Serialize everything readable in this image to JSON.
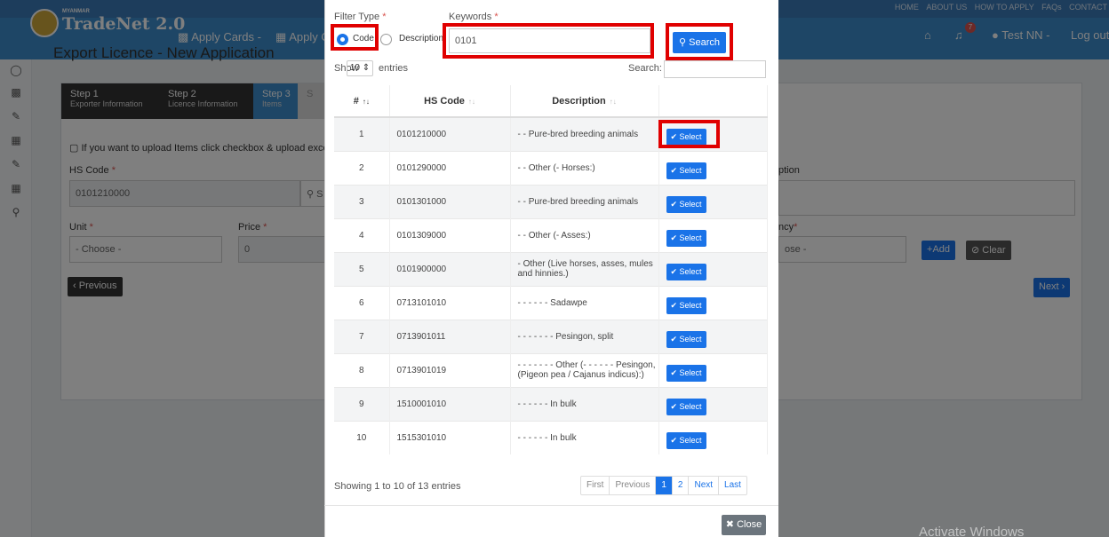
{
  "top_links": [
    "HOME",
    "ABOUT US",
    "HOW TO APPLY",
    "FAQs",
    "CONTACT"
  ],
  "brand": {
    "small": "MYANMAR",
    "name": "TradeNet 2.0"
  },
  "nav": {
    "apply_cards": "Apply Cards -",
    "apply_other": "Apply O",
    "notifications": "7",
    "user": "Test NN -",
    "logout": "Log out"
  },
  "page": {
    "title": "Export Licence - New Application"
  },
  "steps": [
    {
      "title": "Step 1",
      "sub": "Exporter Information"
    },
    {
      "title": "Step 2",
      "sub": "Licence Information"
    },
    {
      "title": "Step 3",
      "sub": "Items"
    },
    {
      "title": "S",
      "sub": "S"
    }
  ],
  "form": {
    "upload_note": "If you want to upload Items click checkbox & upload excel file. Dow",
    "hs_code_label": "HS Code",
    "hs_code_value": "0101210000",
    "hs_search": "S",
    "unit_label": "Unit",
    "unit_value": "- Choose -",
    "price_label": "Price",
    "price_value": "0",
    "description_label": "ption",
    "currency_label": "ncy",
    "currency_value": "ose -",
    "add": "Add",
    "clear": "Clear",
    "previous": "Previous",
    "next": "Next"
  },
  "modal": {
    "filter_type_label": "Filter Type",
    "filter_options": [
      "Code",
      "Description"
    ],
    "filter_selected": "Code",
    "keywords_label": "Keywords",
    "keywords_value": "0101",
    "search_button": "Search",
    "show_label": "Show",
    "page_size": "10",
    "entries_label": "entries",
    "search_label": "Search:",
    "columns": [
      "#",
      "HS Code",
      "Description",
      ""
    ],
    "select_label": "Select",
    "rows": [
      {
        "n": "1",
        "code": "0101210000",
        "desc": "- - Pure-bred breeding animals"
      },
      {
        "n": "2",
        "code": "0101290000",
        "desc": "- - Other (- Horses:)"
      },
      {
        "n": "3",
        "code": "0101301000",
        "desc": "- - Pure-bred breeding animals"
      },
      {
        "n": "4",
        "code": "0101309000",
        "desc": "- - Other (- Asses:)"
      },
      {
        "n": "5",
        "code": "0101900000",
        "desc": "- Other (Live horses, asses, mules and hinnies.)"
      },
      {
        "n": "6",
        "code": "0713101010",
        "desc": "- - - - - - Sadawpe"
      },
      {
        "n": "7",
        "code": "0713901011",
        "desc": "- - - - - - - Pesingon, split"
      },
      {
        "n": "8",
        "code": "0713901019",
        "desc": "- - - - - - - Other (- - - - - - Pesingon, (Pigeon pea / Cajanus indicus):)"
      },
      {
        "n": "9",
        "code": "1510001010",
        "desc": "- - - - - - In bulk"
      },
      {
        "n": "10",
        "code": "1515301010",
        "desc": "- - - - - - In bulk"
      }
    ],
    "info": "Showing 1 to 10 of 13 entries",
    "pagination": [
      "First",
      "Previous",
      "1",
      "2",
      "Next",
      "Last"
    ],
    "current_page": "1",
    "close_button": "Close"
  },
  "watermark": "Activate Windows",
  "colors": {
    "primary": "#1a73e8",
    "navbar": "#3c8dcd",
    "highlight": "#e00000",
    "step_dark": "#333333"
  }
}
